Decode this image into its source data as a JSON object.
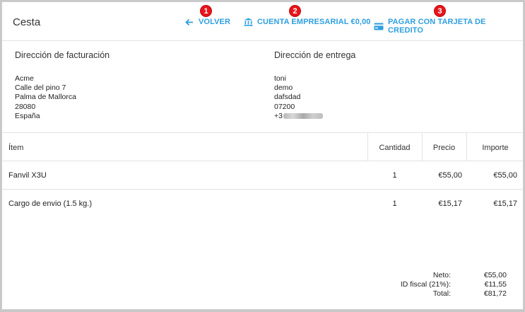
{
  "header": {
    "title": "Cesta",
    "actions": {
      "back": {
        "label": "VOLVER",
        "badge": "1",
        "icon": "arrow-left-icon"
      },
      "business_account": {
        "label": "CUENTA EMPRESARIAL €0,00",
        "badge": "2",
        "icon": "bank-icon"
      },
      "card_payment": {
        "label": "PAGAR CON TARJETA DE CREDITO",
        "badge": "3",
        "icon": "credit-card-icon"
      }
    },
    "accent_color": "#2e9fe0",
    "badge_color": "#e8151b"
  },
  "billing": {
    "title": "Dirección de facturación",
    "lines": [
      "Acme",
      "Calle del pino 7",
      "Palma de Mallorca",
      "28080",
      "España"
    ]
  },
  "shipping": {
    "title": "Dirección de entrega",
    "lines": [
      "toni",
      "demo",
      "dafsdad",
      "07200",
      "+3"
    ]
  },
  "table": {
    "headers": {
      "item": "Ítem",
      "qty": "Cantidad",
      "price": "Precio",
      "amount": "Importe"
    },
    "rows": [
      {
        "item": "Fanvil X3U",
        "qty": "1",
        "price": "€55,00",
        "amount": "€55,00"
      },
      {
        "item": "Cargo de envio (1.5 kg.)",
        "qty": "1",
        "price": "€15,17",
        "amount": "€15,17"
      }
    ]
  },
  "totals": {
    "net": {
      "label": "Neto:",
      "value": "€55,00"
    },
    "tax": {
      "label": "ID fiscal (21%):",
      "value": "€11,55"
    },
    "total": {
      "label": "Total:",
      "value": "€81,72"
    }
  }
}
